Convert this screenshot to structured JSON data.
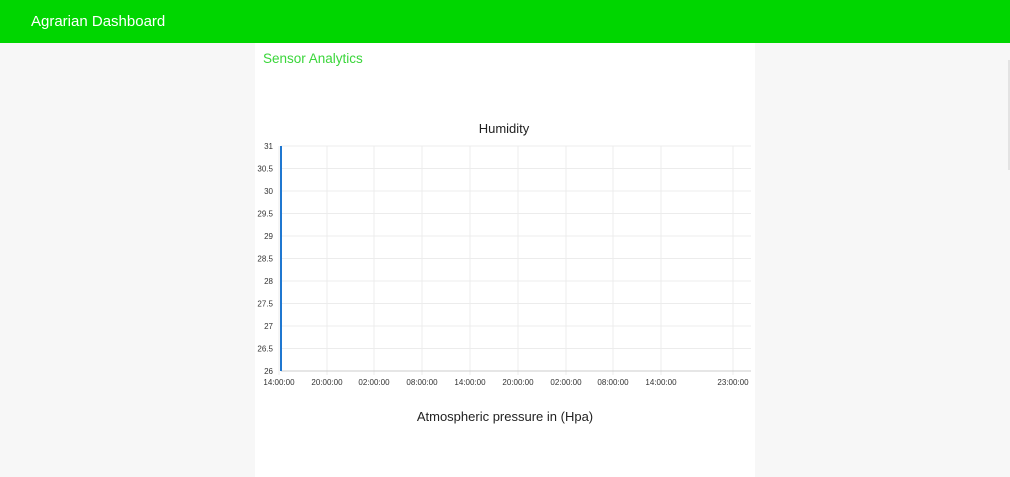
{
  "header": {
    "title": "Agrarian Dashboard"
  },
  "colors": {
    "header_bg": "#00d600",
    "accent_text": "#3ad63a",
    "series": "#1f77d0"
  },
  "section": {
    "title": "Sensor Analytics"
  },
  "charts": {
    "humidity_title": "Humidity",
    "pressure_title": "Atmospheric pressure in (Hpa)"
  },
  "chart_data": [
    {
      "type": "line",
      "title": "Humidity",
      "xlabel": "",
      "ylabel": "",
      "x_ticks": [
        "14:00:00",
        "20:00:00",
        "02:00:00",
        "08:00:00",
        "14:00:00",
        "20:00:00",
        "02:00:00",
        "08:00:00",
        "14:00:00",
        "23:00:00"
      ],
      "y_ticks": [
        "26",
        "26.5",
        "27",
        "27.5",
        "28",
        "28.5",
        "29",
        "29.5",
        "30",
        "30.5",
        "31"
      ],
      "ylim": [
        26,
        31
      ],
      "grid": true,
      "series": [
        {
          "color": "#1f77d0",
          "points": [
            {
              "x": "14:00:00",
              "y": 31
            },
            {
              "x": "14:00:00",
              "y": 26
            }
          ]
        }
      ]
    },
    {
      "type": "line",
      "title": "Atmospheric pressure in (Hpa)"
    }
  ]
}
